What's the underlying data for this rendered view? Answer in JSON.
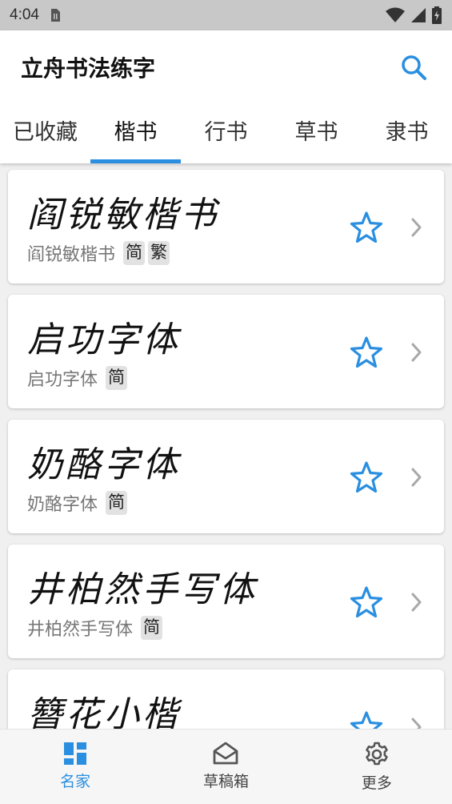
{
  "status_bar": {
    "time": "4:04",
    "icons": [
      "sim-card-icon",
      "wifi-icon",
      "signal-icon",
      "battery-icon"
    ]
  },
  "app_bar": {
    "title": "立舟书法练字",
    "search_icon": "search-icon"
  },
  "tabs": [
    {
      "label": "已收藏",
      "active": false
    },
    {
      "label": "楷书",
      "active": true
    },
    {
      "label": "行书",
      "active": false
    },
    {
      "label": "草书",
      "active": false
    },
    {
      "label": "隶书",
      "active": false
    }
  ],
  "fonts": [
    {
      "sample": "阎锐敏楷书",
      "name": "阎锐敏楷书",
      "tags": [
        "简",
        "繁"
      ]
    },
    {
      "sample": "启功字体",
      "name": "启功字体",
      "tags": [
        "简"
      ]
    },
    {
      "sample": "奶酪字体",
      "name": "奶酪字体",
      "tags": [
        "简"
      ]
    },
    {
      "sample": "井柏然手写体",
      "name": "井柏然手写体",
      "tags": [
        "简"
      ]
    },
    {
      "sample": "簪花小楷",
      "name": "",
      "tags": []
    }
  ],
  "bottom_nav": [
    {
      "label": "名家",
      "icon": "dashboard-icon",
      "active": true
    },
    {
      "label": "草稿箱",
      "icon": "mail-icon",
      "active": false
    },
    {
      "label": "更多",
      "icon": "gear-icon",
      "active": false
    }
  ],
  "colors": {
    "accent": "#2a8fe0",
    "status_bar": "#c8c8c8",
    "background": "#f0f0f0"
  }
}
